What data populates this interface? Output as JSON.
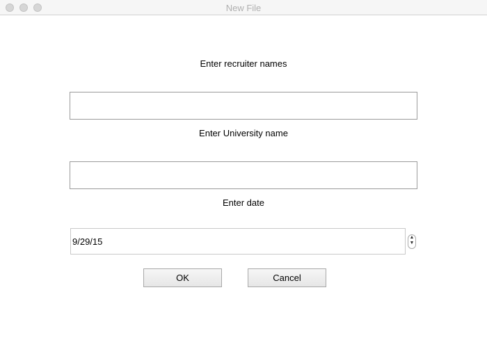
{
  "window": {
    "title": "New File"
  },
  "form": {
    "recruiter_label": "Enter recruiter names",
    "recruiter_value": "",
    "university_label": "Enter University name",
    "university_value": "",
    "date_label": "Enter date",
    "date_value": "9/29/15"
  },
  "buttons": {
    "ok": "OK",
    "cancel": "Cancel"
  }
}
